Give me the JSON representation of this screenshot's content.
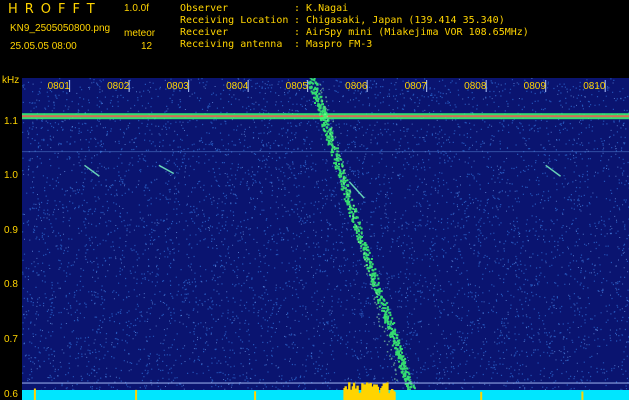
{
  "header": {
    "logo": "HROFFT",
    "version": "1.0.0f",
    "filename": "KN9_2505050800.png",
    "datetime": "25.05.05 08:00",
    "meteor_label": "meteor",
    "meteor_count": "12",
    "rows": [
      {
        "label": "Observer",
        "value": "K.Nagai"
      },
      {
        "label": "Receiving Location",
        "value": "Chigasaki, Japan (139.414 35.340)"
      },
      {
        "label": "Receiver",
        "value": "AirSpy mini (Miakejima VOR 108.65MHz)"
      },
      {
        "label": "Receiving antenna",
        "value": "Maspro FM-3"
      }
    ]
  },
  "chart_data": {
    "type": "heatmap",
    "ylabel": "kHz",
    "y_ticks": [
      "1.1",
      "1.0",
      "0.9",
      "0.8",
      "0.7",
      "0.6"
    ],
    "x_ticks": [
      "0801",
      "0802",
      "0803",
      "0804",
      "0805",
      "0806",
      "0807",
      "0808",
      "0809",
      "0810"
    ],
    "ylim": [
      0.59,
      1.18
    ],
    "xlim_minutes": [
      0.2,
      10.4
    ],
    "carrier_khz": 1.11,
    "meteor_count": 12,
    "colors": {
      "background": "#0a1470",
      "noise": "#2f6fd8",
      "signal": "#3cff70",
      "peak": "#ffd400",
      "carrier": "#ff5050",
      "baseline": "#00e6ff"
    }
  }
}
